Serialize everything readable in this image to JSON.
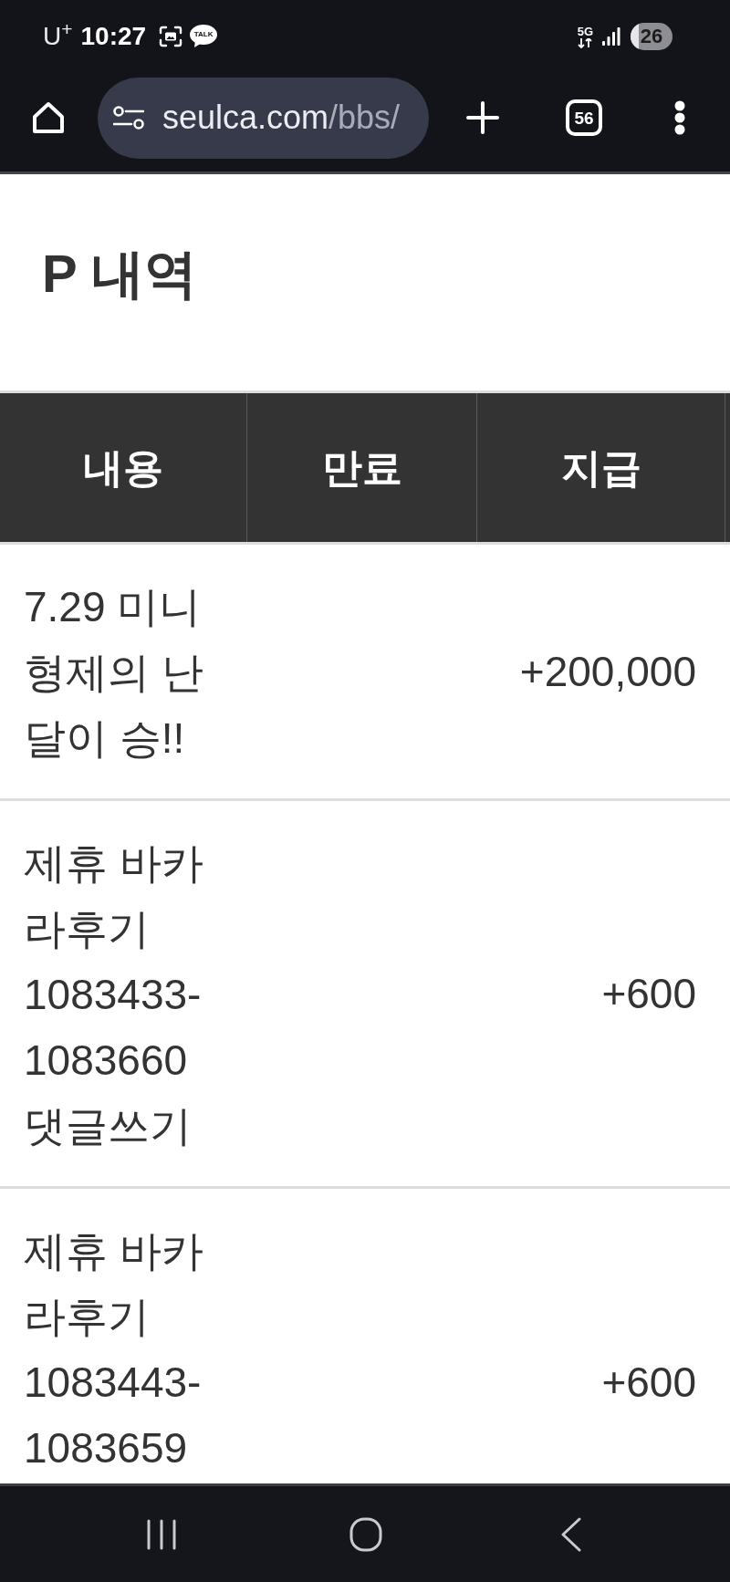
{
  "status_bar": {
    "carrier": "U$^{+}$",
    "time": "10:27",
    "notification_icons": [
      {
        "kind": "screenshot"
      },
      {
        "kind": "chat",
        "label": "TALK"
      }
    ],
    "network": "5G",
    "battery": "26"
  },
  "browser_toolbar": {
    "url_host": "seulca.com",
    "url_path": "/bbs/",
    "tab_count": "56"
  },
  "page_title": "P 내역",
  "table": {
    "columns": [
      "내용",
      "만료",
      "지급"
    ],
    "rows": [
      {
        "content": "7.29 미니 형제의 난 달이 승!!",
        "amount": "+200,000"
      },
      {
        "content": "제휴 바카라후기 1083433-1083660 댓글쓰기",
        "amount": "+600"
      },
      {
        "content": "제휴 바카라후기 1083443-1083659",
        "amount": "+600"
      }
    ]
  }
}
